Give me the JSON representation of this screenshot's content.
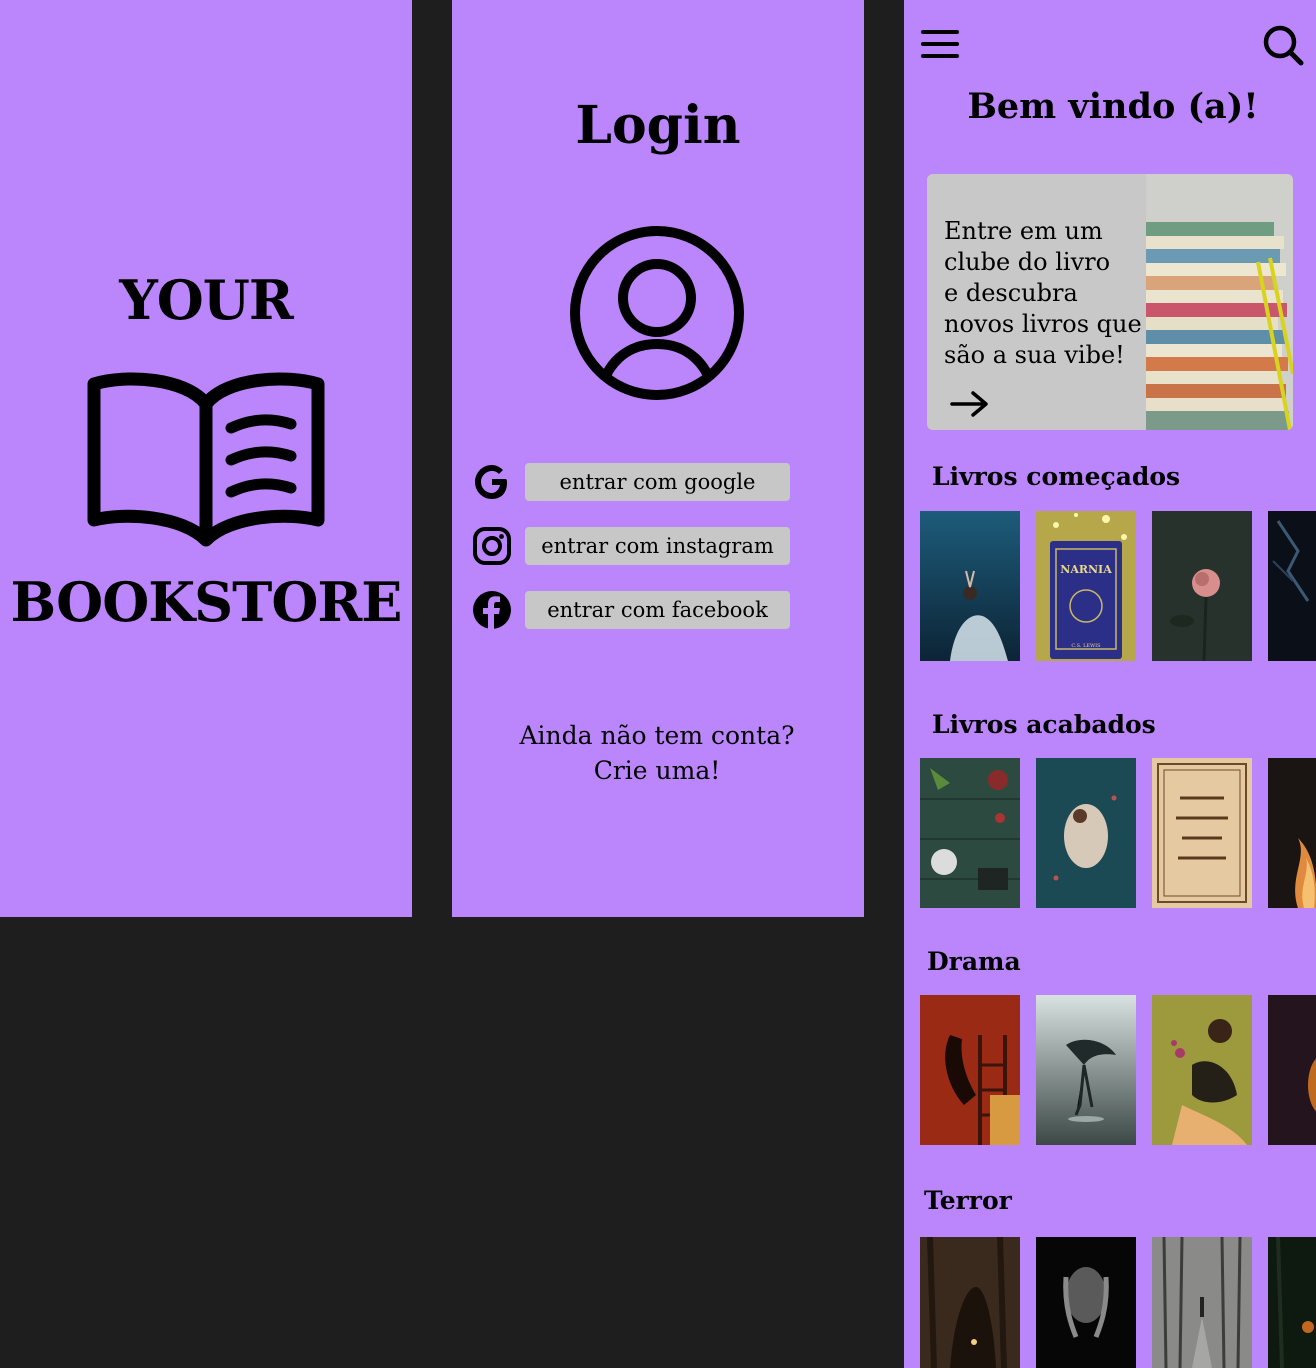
{
  "splash": {
    "brand_top": "YOUR",
    "brand_bottom": "BOOKSTORE",
    "logo_icon": "open-book-icon"
  },
  "login": {
    "title": "Login",
    "avatar_icon": "user-circle-icon",
    "providers": [
      {
        "icon": "google-icon",
        "label": "entrar com google"
      },
      {
        "icon": "instagram-icon",
        "label": "entrar com instagram"
      },
      {
        "icon": "facebook-icon",
        "label": "entrar com facebook"
      }
    ],
    "signup_line1": "Ainda não tem conta?",
    "signup_line2": "Crie uma!"
  },
  "home": {
    "menu_icon": "hamburger-menu-icon",
    "search_icon": "search-icon",
    "welcome": "Bem vindo (a)!",
    "banner": {
      "lines": [
        "Entre em um",
        "clube do livro",
        "e descubra",
        "novos livros que",
        "são a sua vibe!"
      ],
      "arrow_icon": "arrow-right-icon"
    },
    "sections": [
      {
        "title": "Livros começados"
      },
      {
        "title": "Livros acabados"
      },
      {
        "title": "Drama"
      },
      {
        "title": "Terror"
      }
    ],
    "cover_texts": {
      "narnia_title": "NARNIA",
      "narnia_author": "C.S. LEWIS"
    }
  },
  "colors": {
    "screen_bg": "#bb86fc",
    "canvas_bg": "#1e1e1e",
    "button_bg": "#c7c7c7",
    "banner_bg": "#c8c8c8"
  }
}
